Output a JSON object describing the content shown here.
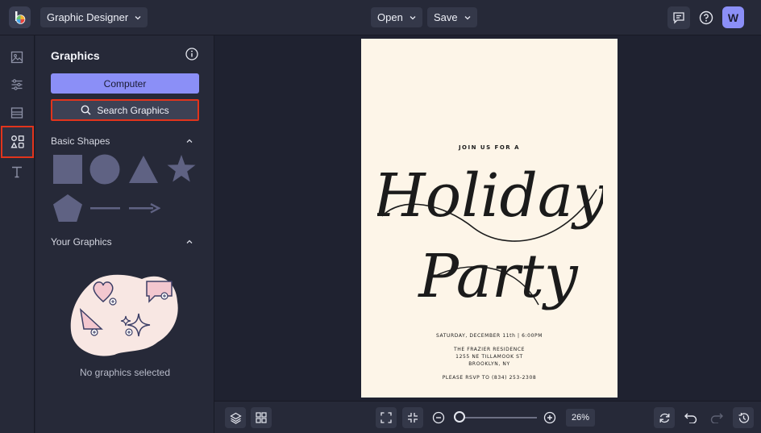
{
  "topbar": {
    "app_name": "Graphic Designer",
    "open_label": "Open",
    "save_label": "Save",
    "avatar_initial": "W"
  },
  "rail": {
    "items": [
      "image-icon",
      "sliders-icon",
      "layout-icon",
      "graphics-icon",
      "text-icon"
    ],
    "active": "graphics-icon"
  },
  "panel": {
    "title": "Graphics",
    "computer_button": "Computer",
    "search_button": "Search Graphics",
    "basic_shapes_title": "Basic Shapes",
    "shapes": [
      "square",
      "circle",
      "triangle",
      "star",
      "pentagon",
      "line",
      "arrow"
    ],
    "your_graphics_title": "Your Graphics",
    "empty_text": "No graphics selected"
  },
  "document": {
    "join_line": "JOIN US FOR A",
    "script_line1": "Holiday",
    "script_line2": "Party",
    "date_line": "SATURDAY, DECEMBER 11th | 6:00PM",
    "venue_line1": "THE FRAZIER RESIDENCE",
    "venue_line2": "1255 NE TILLAMOOK ST",
    "venue_line3": "BROOKLYN, NY",
    "rsvp_line": "PLEASE RSVP TO (834) 253-2308"
  },
  "bottombar": {
    "zoom_label": "26%",
    "zoom_percent": 26
  },
  "colors": {
    "accent": "#8b8ff7",
    "highlight": "#e2341c",
    "page_bg": "#fdf5e8",
    "shape_fill": "#5f6283"
  }
}
